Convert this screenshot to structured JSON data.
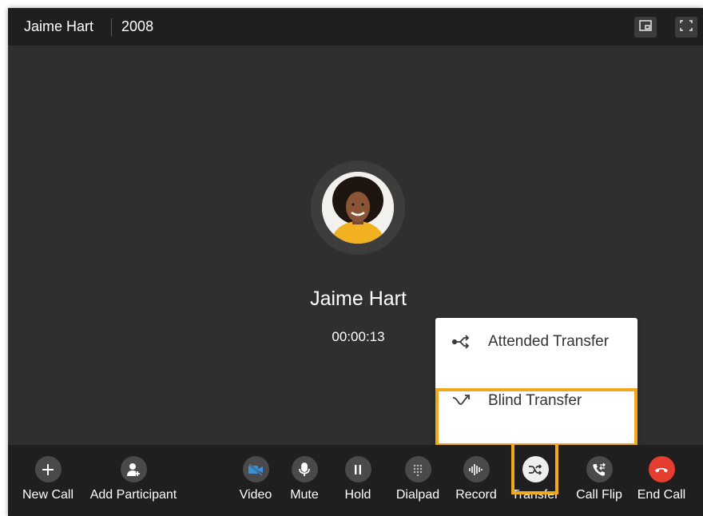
{
  "header": {
    "contact_name": "Jaime Hart",
    "extension": "2008"
  },
  "caller": {
    "name": "Jaime Hart",
    "duration": "00:00:13"
  },
  "transfer_menu": {
    "items": [
      {
        "label": "Attended Transfer",
        "icon": "attended-transfer-icon"
      },
      {
        "label": "Blind Transfer",
        "icon": "blind-transfer-icon"
      }
    ]
  },
  "toolbar": {
    "buttons": [
      {
        "label": "New Call",
        "icon": "plus-icon"
      },
      {
        "label": "Add Participant",
        "icon": "add-person-icon"
      },
      {
        "label": "Video",
        "icon": "video-off-icon"
      },
      {
        "label": "Mute",
        "icon": "microphone-icon"
      },
      {
        "label": "Hold",
        "icon": "pause-icon"
      },
      {
        "label": "Dialpad",
        "icon": "dialpad-icon"
      },
      {
        "label": "Record",
        "icon": "waveform-icon"
      },
      {
        "label": "Transfer",
        "icon": "transfer-icon"
      },
      {
        "label": "Call Flip",
        "icon": "call-flip-icon"
      },
      {
        "label": "End Call",
        "icon": "hangup-icon"
      }
    ]
  },
  "colors": {
    "background": "#2f2f2f",
    "bar": "#1f1f1f",
    "button": "#4a4a4a",
    "video_accent": "#3d8fd6",
    "end_call": "#e53d2f",
    "highlight": "#f0a81c"
  }
}
